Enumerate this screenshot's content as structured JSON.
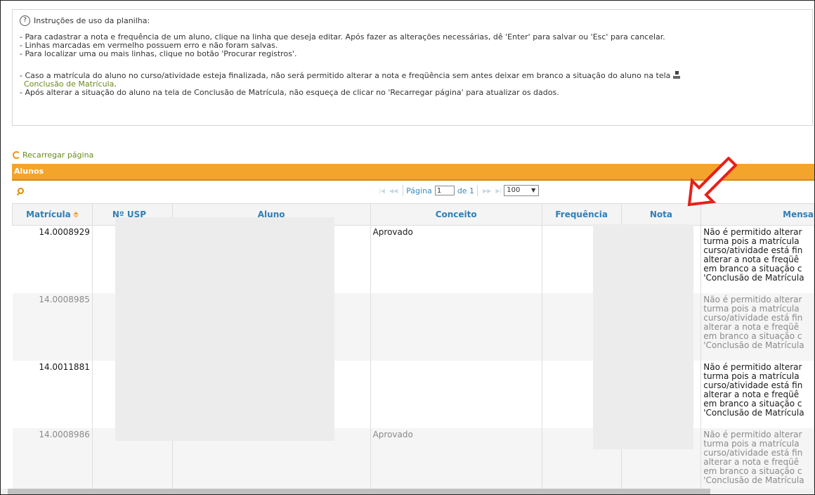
{
  "instructions": {
    "title": "Instruções de uso da planilha:",
    "lines": [
      "- Para cadastrar a nota e frequência de um aluno, clique na linha que deseja editar. Após fazer as alterações necessárias, dê 'Enter' para salvar ou 'Esc' para cancelar.",
      "- Linhas marcadas em vermelho possuem erro e não foram salvas.",
      "- Para localizar uma ou mais linhas, clique no botão 'Procurar registros'."
    ],
    "line4": "- Caso a matrícula do aluno no curso/atividade esteja finalizada, não será permitido alterar a nota e freqüência sem antes deixar em branco a situação do aluno na tela",
    "line4_link": "Conclusão de Matrícula",
    "line5": "- Após alterar a situação do aluno na tela de Conclusão de Matrícula, não esqueça de clicar no 'Recarregar página' para atualizar os dados."
  },
  "reload_label": "Recarregar página",
  "grid": {
    "title": "Alunos",
    "pager": {
      "page_label": "Página",
      "page_value": "1",
      "of_label": "de 1",
      "page_size": "100"
    },
    "columns": [
      "Matrícula",
      "Nº USP",
      "Aluno",
      "Conceito",
      "Frequência",
      "Nota",
      "Mensa"
    ],
    "rows": [
      {
        "matricula": "14.0008929",
        "nusp": "",
        "aluno": "",
        "conceito": "Aprovado",
        "frequencia": "",
        "nota": "",
        "mensagem": "Não é permitido alterar turma pois a matrícula curso/atividade está fin alterar a nota e freqüê em branco a situação c 'Conclusão de Matrícula"
      },
      {
        "matricula": "14.0008985",
        "nusp": "",
        "aluno": "",
        "conceito": "",
        "frequencia": "",
        "nota": "",
        "mensagem": "Não é permitido alterar turma pois a matrícula curso/atividade está fin alterar a nota e freqüê em branco a situação c 'Conclusão de Matrícula"
      },
      {
        "matricula": "14.0011881",
        "nusp": "",
        "aluno": "",
        "conceito": "",
        "frequencia": "",
        "nota": "",
        "mensagem": "Não é permitido alterar turma pois a matrícula curso/atividade está fin alterar a nota e freqüê em branco a situação c 'Conclusão de Matrícula"
      },
      {
        "matricula": "14.0008986",
        "nusp": "",
        "aluno": "",
        "conceito": "Aprovado",
        "frequencia": "",
        "nota": "",
        "mensagem": "Não é permitido alterar turma pois a matrícula curso/atividade está fin alterar a nota e freqüê em branco a situação c 'Conclusão de Matrícula"
      }
    ]
  },
  "colors": {
    "accent_orange": "#f3a42b",
    "header_text_blue": "#2e7fb8",
    "link_green": "#6a8a1c",
    "annotation_red": "#e8201a"
  }
}
